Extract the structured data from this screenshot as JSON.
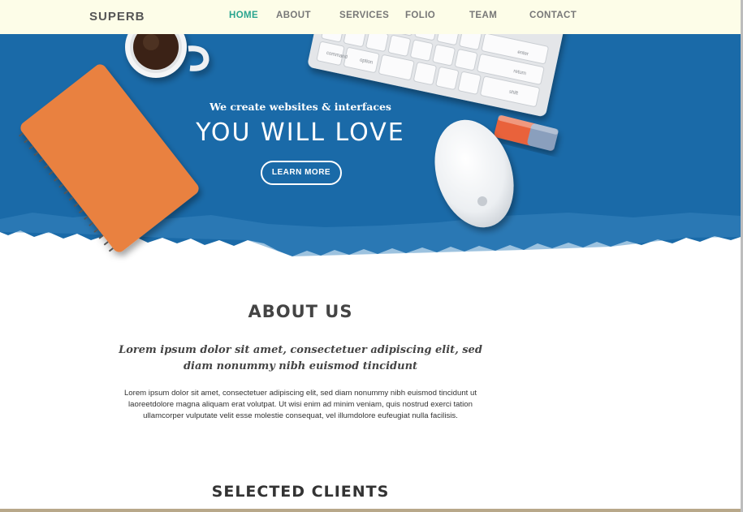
{
  "nav": {
    "brand": "SUPERB",
    "items": [
      {
        "label": "HOME",
        "active": true
      },
      {
        "label": "ABOUT",
        "active": false
      },
      {
        "label": "SERVICES",
        "active": false
      },
      {
        "label": "FOLIO",
        "active": false
      },
      {
        "label": "TEAM",
        "active": false
      },
      {
        "label": "CONTACT",
        "active": false
      }
    ]
  },
  "hero": {
    "tagline": "We create websites & interfaces",
    "headline": "YOU WILL LOVE",
    "cta_label": "LEARN MORE",
    "keyboard_keys": [
      "M",
      "<",
      ">",
      "?",
      "command",
      "option",
      "enter",
      "return",
      "shift"
    ]
  },
  "about": {
    "title": "ABOUT US",
    "lead": "Lorem ipsum dolor sit amet, consectetuer adipiscing elit, sed diam nonummy nibh euismod tincidunt",
    "body": "Lorem ipsum dolor sit amet, consectetuer adipiscing elit, sed diam nonummy nibh euismod tincidunt ut laoreetdolore magna aliquam erat volutpat. Ut wisi enim ad minim veniam, quis nostrud exerci tation ullamcorper vulputate velit esse molestie consequat, vel illumdolore eufeugiat nulla facilisis."
  },
  "clients": {
    "title": "SELECTED CLIENTS"
  },
  "colors": {
    "hero_blue": "#1a6aa8",
    "nav_bg": "#fdfde8",
    "active_link": "#2aa58f",
    "notebook": "#e98140",
    "bottom_rule": "#b8a88a"
  }
}
